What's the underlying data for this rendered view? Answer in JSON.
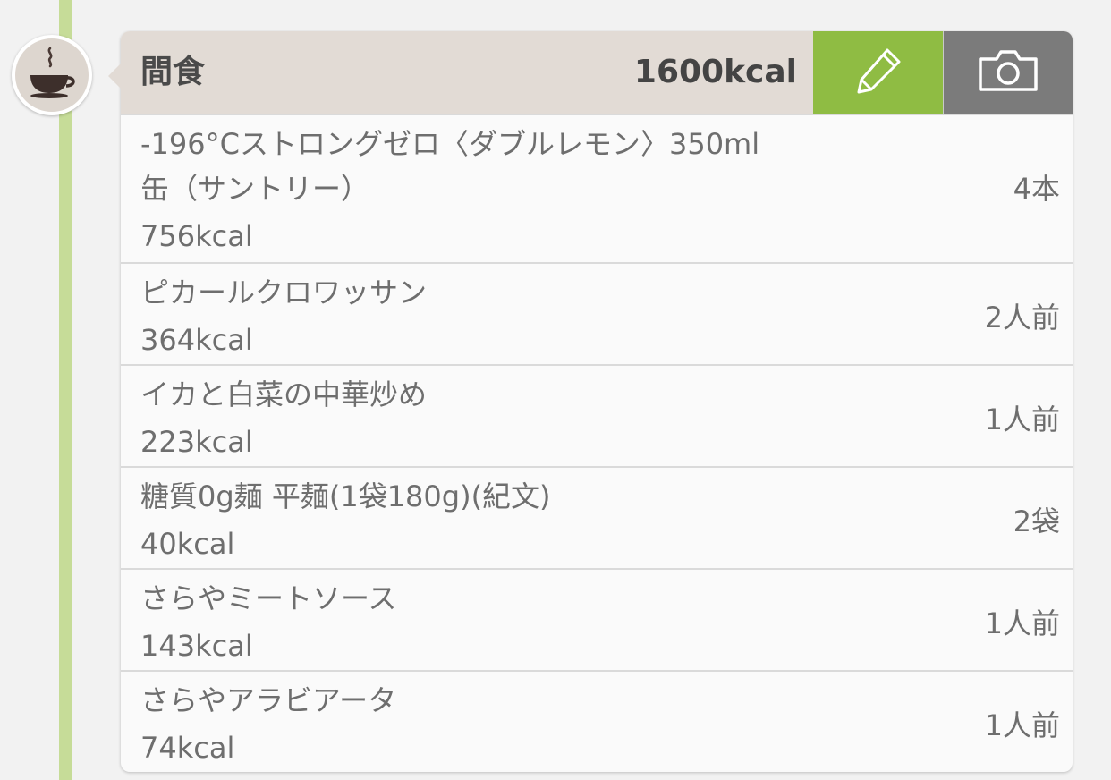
{
  "meal": {
    "icon": "coffee-cup-icon",
    "title": "間食",
    "total_kcal": "1600kcal",
    "edit_icon": "pencil-icon",
    "camera_icon": "camera-icon",
    "colors": {
      "timeline": "#c6dc98",
      "header_bg": "#e2dbd5",
      "edit_bg": "#8fbc43",
      "camera_bg": "#7b7b7b"
    }
  },
  "items": [
    {
      "name_line1": "-196°Cストロングゼロ〈ダブルレモン〉350ml",
      "name_line2": "缶（サントリー）",
      "kcal": "756kcal",
      "quantity": "4本"
    },
    {
      "name_line1": "ピカールクロワッサン",
      "kcal": "364kcal",
      "quantity": "2人前"
    },
    {
      "name_line1": "イカと白菜の中華炒め",
      "kcal": "223kcal",
      "quantity": "1人前"
    },
    {
      "name_line1": "糖質0g麺 平麺(1袋180g)(紀文)",
      "kcal": "40kcal",
      "quantity": "2袋"
    },
    {
      "name_line1": "さらやミートソース",
      "kcal": "143kcal",
      "quantity": "1人前"
    },
    {
      "name_line1": "さらやアラビアータ",
      "kcal": "74kcal",
      "quantity": "1人前"
    }
  ]
}
